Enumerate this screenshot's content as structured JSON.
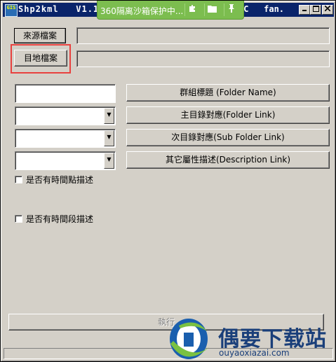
{
  "window": {
    "title": "Shp2kml   V1.1",
    "title_right": "CC   fan.",
    "app_icon_text": "GIS"
  },
  "overlay_360": {
    "text": "360隔离沙箱保护中...",
    "icons": [
      "puzzle-icon",
      "folder-icon",
      "pin-icon"
    ]
  },
  "buttons": {
    "source_file": "來源檔案",
    "target_file": "目地檔案",
    "group_title": "群組標題 (Folder Name)",
    "main_dir": "主目錄對應(Folder  Link)",
    "sub_dir": "次目錄對應(Sub Folder Link)",
    "other_attr": "其它屬性描述(Description Link)",
    "execute": "執行"
  },
  "fields": {
    "source_path": "",
    "target_path": "",
    "folder_name": "",
    "folder_link": "",
    "sub_folder_link": "",
    "description_link": ""
  },
  "checkboxes": {
    "time_point": "是否有時間點描述",
    "time_span": "是否有時間段描述"
  },
  "watermark": {
    "name": "偶要下载站",
    "url": "ouyaoxiazai.com"
  }
}
